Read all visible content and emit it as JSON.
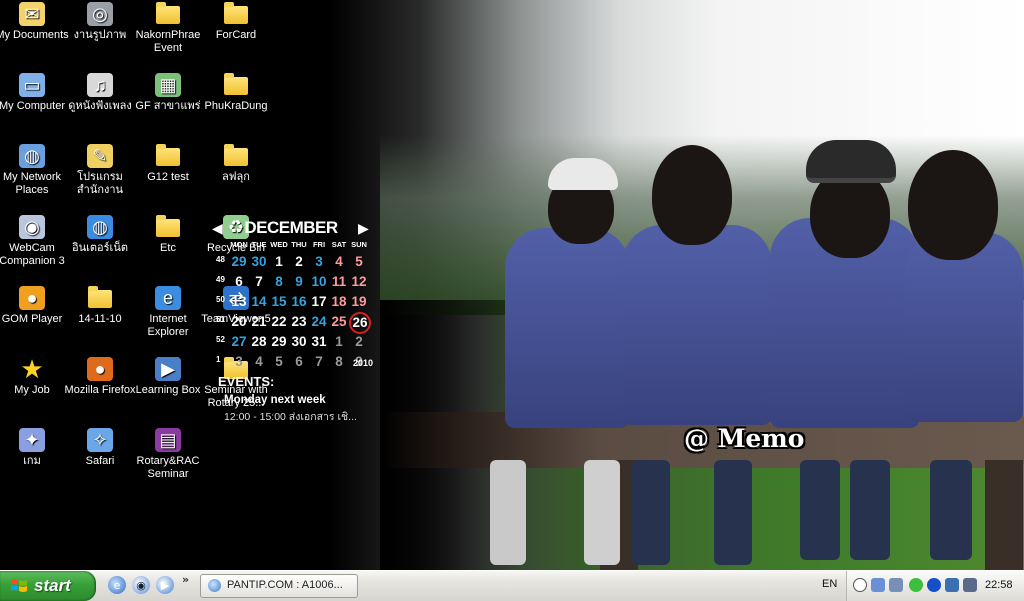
{
  "desktop": {
    "icons": [
      {
        "label": "My Documents",
        "icon": "my-documents-icon"
      },
      {
        "label": "งานรูปภาพ",
        "icon": "camera-icon"
      },
      {
        "label": "NakornPhrae Event",
        "icon": "folder-icon"
      },
      {
        "label": "ForCard",
        "icon": "folder-icon"
      },
      {
        "label": "My Computer",
        "icon": "my-computer-icon"
      },
      {
        "label": "ดูหนังฟังเพลง",
        "icon": "music-icon"
      },
      {
        "label": "GF สาขาแพร่",
        "icon": "spreadsheet-icon"
      },
      {
        "label": "PhuKraDung",
        "icon": "folder-icon"
      },
      {
        "label": "My Network Places",
        "icon": "network-icon"
      },
      {
        "label": "โปรแกรมสำนักงาน",
        "icon": "folder-shortcut-icon"
      },
      {
        "label": "G12 test",
        "icon": "folder-icon"
      },
      {
        "label": "ลฟลุก",
        "icon": "folder-icon"
      },
      {
        "label": "WebCam Companion 3",
        "icon": "webcam-icon"
      },
      {
        "label": "อินเตอร์เน็ต",
        "icon": "globe-icon"
      },
      {
        "label": "Etc",
        "icon": "folder-icon"
      },
      {
        "label": "Recycle Bin",
        "icon": "recycle-bin-icon"
      },
      {
        "label": "GOM Player",
        "icon": "gom-player-icon"
      },
      {
        "label": "14-11-10",
        "icon": "folder-icon"
      },
      {
        "label": "Internet Explorer",
        "icon": "internet-explorer-icon"
      },
      {
        "label": "TeamViewer 5",
        "icon": "teamviewer-icon"
      },
      {
        "label": "My Job",
        "icon": "star-icon"
      },
      {
        "label": "Mozilla Firefox",
        "icon": "firefox-icon"
      },
      {
        "label": "Learning Box",
        "icon": "play-icon"
      },
      {
        "label": "Seminar with Rotary 25...",
        "icon": "folder-icon"
      },
      {
        "label": "เกม",
        "icon": "gamepad-icon"
      },
      {
        "label": "Safari",
        "icon": "safari-icon"
      },
      {
        "label": "Rotary&RAC Seminar",
        "icon": "winrar-icon"
      }
    ]
  },
  "calendar": {
    "month": "DECEMBER",
    "year": "2010",
    "weekdays": [
      "MON",
      "TUE",
      "WED",
      "THU",
      "FRI",
      "SAT",
      "SUN"
    ],
    "weeks": [
      {
        "wk": "48",
        "days": [
          "29",
          "30",
          "1",
          "2",
          "3",
          "4",
          "5"
        ]
      },
      {
        "wk": "49",
        "days": [
          "6",
          "7",
          "8",
          "9",
          "10",
          "11",
          "12"
        ]
      },
      {
        "wk": "50",
        "days": [
          "13",
          "14",
          "15",
          "16",
          "17",
          "18",
          "19"
        ]
      },
      {
        "wk": "51",
        "days": [
          "20",
          "21",
          "22",
          "23",
          "24",
          "25",
          "26"
        ]
      },
      {
        "wk": "52",
        "days": [
          "27",
          "28",
          "29",
          "30",
          "31",
          "1",
          "2"
        ]
      },
      {
        "wk": "1",
        "days": [
          "3",
          "4",
          "5",
          "6",
          "7",
          "8",
          "9"
        ]
      }
    ],
    "today": "26",
    "colors": {
      "weekday": "#ffffff",
      "weekend": "#ff9b9b",
      "highlight": "#34a3e0",
      "muted": "#9a9a9a",
      "today_ring": "#d81f1f"
    },
    "events_title": "EVENTS:",
    "events": [
      {
        "name": "Monday next week",
        "time": "12:00 - 15:00 ส่งเอกสาร เชิ..."
      }
    ]
  },
  "wallpaper": {
    "caption": "@ Memo"
  },
  "taskbar": {
    "start_label": "start",
    "quick_launch": [
      "ie-icon",
      "media-icon",
      "play-icon"
    ],
    "more": "»",
    "task_button": "PANTIP.COM : A1006...",
    "language": "EN",
    "clock": "22:58"
  }
}
